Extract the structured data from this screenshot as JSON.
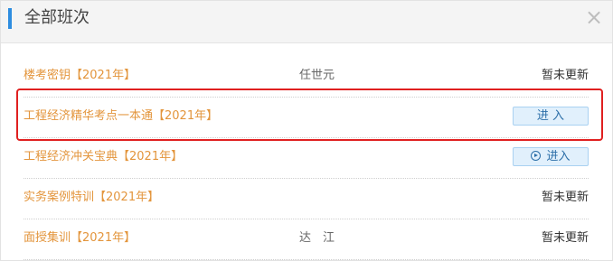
{
  "dialog": {
    "title": "全部班次",
    "close_glyph": "×"
  },
  "courses": [
    {
      "title": "楼考密钥【2021年】",
      "teacher": "任世元",
      "status": "暂未更新",
      "button": null
    },
    {
      "title": "工程经济精华考点一本通【2021年】",
      "teacher": "",
      "status": "",
      "button": "进 入",
      "button_icon": false
    },
    {
      "title": "工程经济冲关宝典【2021年】",
      "teacher": "",
      "status": "",
      "button": "进入",
      "button_icon": true
    },
    {
      "title": "实务案例特训【2021年】",
      "teacher": "",
      "status": "暂未更新",
      "button": null
    },
    {
      "title": "面授集训【2021年】",
      "teacher": "达　江",
      "status": "暂未更新",
      "button": null
    }
  ],
  "colors": {
    "accent": "#2e8de0",
    "course_title": "#e3953c",
    "highlight_border": "#e02020",
    "button_bg": "#e1f0fc"
  }
}
